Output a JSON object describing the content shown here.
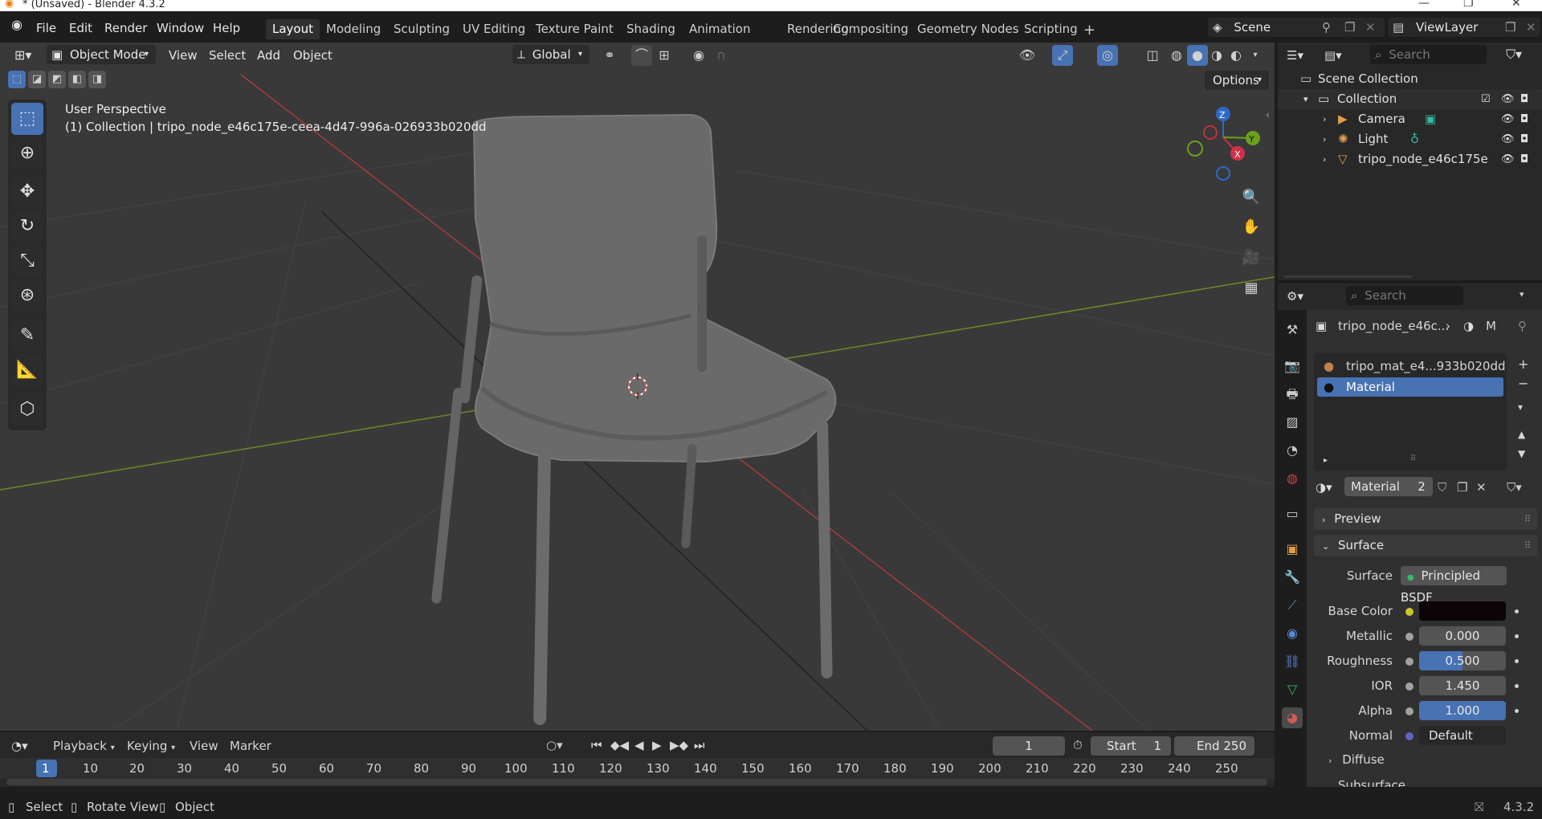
{
  "window": {
    "title": "* (Unsaved) - Blender 4.3.2"
  },
  "menu": [
    "File",
    "Edit",
    "Render",
    "Window",
    "Help"
  ],
  "workspaces": [
    "Layout",
    "Modeling",
    "Sculpting",
    "UV Editing",
    "Texture Paint",
    "Shading",
    "Animation",
    "Rendering",
    "Compositing",
    "Geometry Nodes",
    "Scripting"
  ],
  "scene": {
    "name": "Scene",
    "view_layer": "ViewLayer"
  },
  "viewport_header": {
    "mode": "Object Mode",
    "menus": [
      "View",
      "Select",
      "Add",
      "Object"
    ],
    "orientation": "Global",
    "options_label": "Options"
  },
  "viewport": {
    "perspective": "User Perspective",
    "collection_info": "(1) Collection | tripo_node_e46c175e-ceea-4d47-996a-026933b020dd",
    "gizmo_axes": [
      "Z",
      "Y",
      "X"
    ]
  },
  "outliner": {
    "search_placeholder": "Search",
    "root": "Scene Collection",
    "collection": "Collection",
    "items": [
      "Camera",
      "Light",
      "tripo_node_e46c175e"
    ]
  },
  "properties": {
    "search_placeholder": "Search",
    "breadcrumb_object": "tripo_node_e46c...",
    "breadcrumb_material": "M",
    "slots": [
      "tripo_mat_e4...933b020dd",
      "Material"
    ],
    "material_name": "Material",
    "material_users": "2",
    "panels": {
      "preview": "Preview",
      "surface": "Surface",
      "diffuse": "Diffuse",
      "subsurface": "Subsurface"
    },
    "surface_label": "Surface",
    "surface_shader": "Principled BSDF",
    "fields": [
      {
        "label": "Base Color",
        "value": "",
        "socket": "#c7c729"
      },
      {
        "label": "Metallic",
        "value": "0.000",
        "fill": 0.0,
        "socket": "#a1a1a1"
      },
      {
        "label": "Roughness",
        "value": "0.500",
        "fill": 0.5,
        "socket": "#a1a1a1"
      },
      {
        "label": "IOR",
        "value": "1.450",
        "fill": 0.0,
        "socket": "#a1a1a1"
      },
      {
        "label": "Alpha",
        "value": "1.000",
        "fill": 1.0,
        "socket": "#a1a1a1"
      },
      {
        "label": "Normal",
        "value": "Default",
        "socket": "#6363c7"
      }
    ],
    "base_color": "#0d0408"
  },
  "timeline": {
    "menus": [
      "Playback",
      "Keying",
      "View",
      "Marker"
    ],
    "current_frame": "1",
    "start_label": "Start",
    "start": "1",
    "end_label": "End",
    "end": "250",
    "ruler": [
      "1",
      "10",
      "20",
      "30",
      "40",
      "50",
      "60",
      "70",
      "80",
      "90",
      "100",
      "110",
      "120",
      "130",
      "140",
      "150",
      "160",
      "170",
      "180",
      "190",
      "200",
      "210",
      "220",
      "230",
      "240",
      "250"
    ]
  },
  "status": {
    "select": "Select",
    "rotate": "Rotate View",
    "object": "Object",
    "version": "4.3.2"
  }
}
